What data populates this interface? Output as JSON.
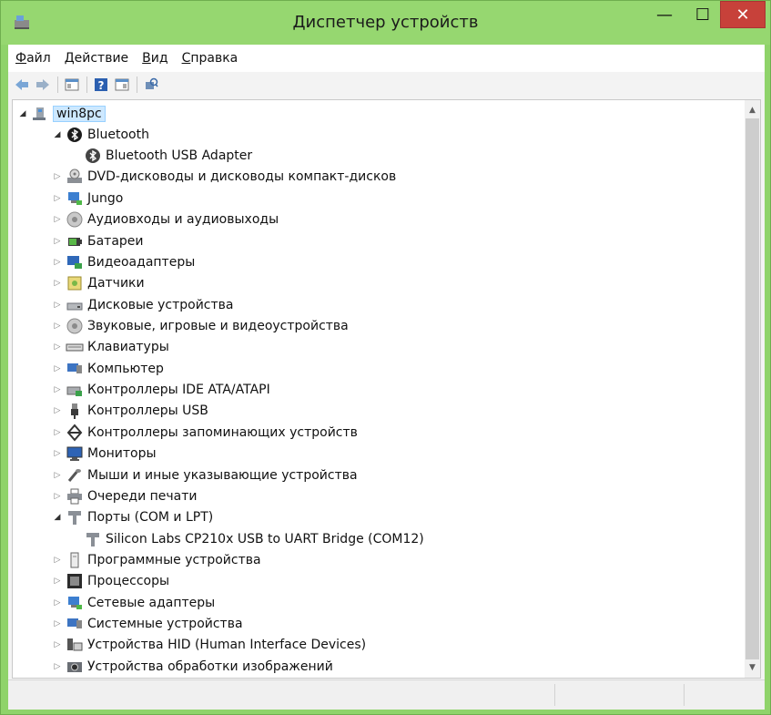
{
  "window": {
    "title": "Диспетчер устройств",
    "controls": {
      "minimize": "—",
      "maximize": "☐",
      "close": "✕"
    }
  },
  "menu": [
    {
      "accel": "Ф",
      "rest": "айл"
    },
    {
      "accel": "Д",
      "rest": "ействие"
    },
    {
      "accel": "В",
      "rest": "ид"
    },
    {
      "accel": "С",
      "rest": "правка"
    }
  ],
  "toolbar": [
    "back-icon",
    "forward-icon",
    "properties-icon",
    "help-icon",
    "view-icon",
    "scan-hardware-icon"
  ],
  "tree": {
    "root": "win8pc",
    "items": [
      {
        "label": "Bluetooth",
        "expanded": true,
        "children": [
          "Bluetooth USB Adapter"
        ]
      },
      {
        "label": "DVD-дисководы и дисководы компакт-дисков"
      },
      {
        "label": "Jungo"
      },
      {
        "label": "Аудиовходы и аудиовыходы"
      },
      {
        "label": "Батареи"
      },
      {
        "label": "Видеоадаптеры"
      },
      {
        "label": "Датчики"
      },
      {
        "label": "Дисковые устройства"
      },
      {
        "label": "Звуковые, игровые и видеоустройства"
      },
      {
        "label": "Клавиатуры"
      },
      {
        "label": "Компьютер"
      },
      {
        "label": "Контроллеры IDE ATA/ATAPI"
      },
      {
        "label": "Контроллеры USB"
      },
      {
        "label": "Контроллеры запоминающих устройств"
      },
      {
        "label": "Мониторы"
      },
      {
        "label": "Мыши и иные указывающие устройства"
      },
      {
        "label": "Очереди печати"
      },
      {
        "label": "Порты (COM и LPT)",
        "expanded": true,
        "children": [
          "Silicon Labs CP210x USB to UART Bridge (COM12)"
        ]
      },
      {
        "label": "Программные устройства"
      },
      {
        "label": "Процессоры"
      },
      {
        "label": "Сетевые адаптеры"
      },
      {
        "label": "Системные устройства"
      },
      {
        "label": "Устройства HID (Human Interface Devices)"
      },
      {
        "label": "Устройства обработки изображений"
      }
    ]
  },
  "colors": {
    "titlebar": "#96d770",
    "close": "#c7413a",
    "selection": "#cde8ff"
  }
}
